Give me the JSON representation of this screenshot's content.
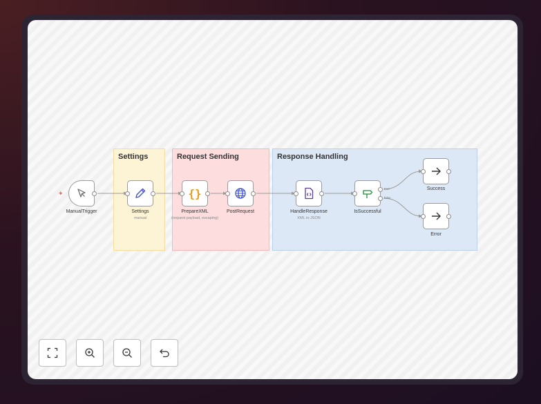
{
  "groups": {
    "settings": "Settings",
    "request": "Request Sending",
    "response": "Response Handling"
  },
  "nodes": {
    "manual_trigger": {
      "label": "ManualTrigger",
      "icon": "cursor-icon"
    },
    "settings": {
      "label": "Settings",
      "sub": "manual",
      "icon": "pencil-icon"
    },
    "prepare_xml": {
      "label": "PrepareXML",
      "sub": "(request payload, escaping)",
      "icon": "braces-icon"
    },
    "post_request": {
      "label": "PostRequest",
      "icon": "globe-icon"
    },
    "handle_response": {
      "label": "HandleResponse",
      "sub": "XML to JSON",
      "icon": "code-file-icon"
    },
    "is_successful": {
      "label": "IsSuccessful",
      "icon": "signpost-icon"
    },
    "success": {
      "label": "Success",
      "icon": "arrow-right-icon"
    },
    "error": {
      "label": "Error",
      "icon": "arrow-right-icon"
    }
  },
  "edges": {
    "true_label": "true",
    "false_label": "false"
  },
  "controls": {
    "fit": "fit-view-icon",
    "zoom_in": "zoom-in-icon",
    "zoom_out": "zoom-out-icon",
    "undo": "undo-icon"
  },
  "colors": {
    "settings_group": "#fdf4d6",
    "request_group": "#fddddd",
    "response_group": "#dde8f6",
    "pencil": "#3b4fd8",
    "braces": "#e69a1b",
    "globe": "#3b4fd8",
    "code_file": "#5b3b9c",
    "signpost": "#1f8a3b"
  }
}
